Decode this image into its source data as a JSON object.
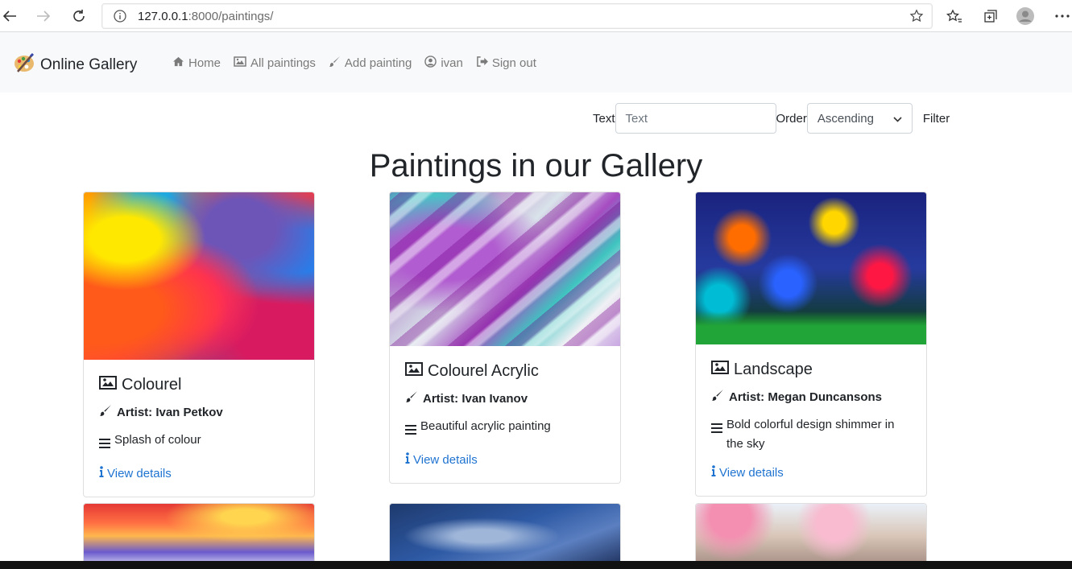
{
  "browser": {
    "url_host": "127.0.0.1",
    "url_rest": ":8000/paintings/"
  },
  "navbar": {
    "brand": "Online Gallery",
    "links": [
      {
        "label": "Home",
        "icon": "home-icon"
      },
      {
        "label": "All paintings",
        "icon": "image-icon"
      },
      {
        "label": "Add painting",
        "icon": "brush-icon"
      },
      {
        "label": "ivan",
        "icon": "user-circle-icon"
      },
      {
        "label": "Sign out",
        "icon": "sign-out-icon"
      }
    ]
  },
  "filter": {
    "text_label": "Text",
    "text_placeholder": "Text",
    "order_label": "Order",
    "order_value": "Ascending",
    "button_label": "Filter"
  },
  "page_title": "Paintings in our Gallery",
  "paintings": [
    {
      "title": "Colourel",
      "artist": "Artist: Ivan Petkov",
      "description": "Splash of colour",
      "link": "View details"
    },
    {
      "title": "Colourel Acrylic",
      "artist": "Artist: Ivan Ivanov",
      "description": "Beautiful acrylic painting",
      "link": "View details"
    },
    {
      "title": "Landscape",
      "artist": "Artist: Megan Duncansons",
      "description": "Bold colorful design shimmer in the sky",
      "link": "View details"
    }
  ],
  "colors": {
    "link": "#1f73d1",
    "navbar_bg": "#f8f9fa",
    "nav_link": "#7a7a7a"
  }
}
